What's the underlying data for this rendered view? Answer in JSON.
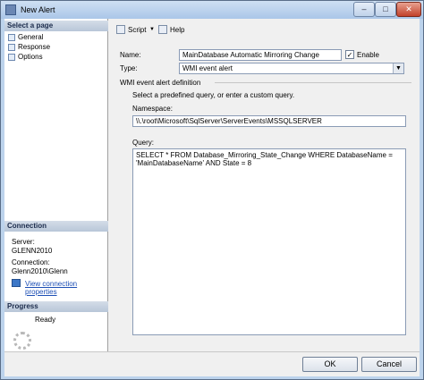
{
  "window": {
    "title": "New Alert"
  },
  "left": {
    "select_page_header": "Select a page",
    "pages": [
      "General",
      "Response",
      "Options"
    ],
    "connection_header": "Connection",
    "server_label": "Server:",
    "server_value": "GLENN2010",
    "connection_label": "Connection:",
    "connection_value": "Glenn2010\\Glenn",
    "view_properties_link": "View connection properties",
    "progress_header": "Progress",
    "progress_status": "Ready"
  },
  "toolbar": {
    "script_label": "Script",
    "help_label": "Help"
  },
  "form": {
    "name_label": "Name:",
    "name_value": "MainDatabase Automatic Mirroring Change",
    "enable_label": "Enable",
    "enable_checked": true,
    "type_label": "Type:",
    "type_value": "WMI event alert",
    "wmi_group_label": "WMI event alert definition",
    "instruction": "Select a predefined query, or enter a custom query.",
    "namespace_label": "Namespace:",
    "namespace_value": "\\\\.\\root\\Microsoft\\SqlServer\\ServerEvents\\MSSQLSERVER",
    "query_label": "Query:",
    "query_line1": "SELECT * FROM Database_Mirroring_State_Change WHERE DatabaseName =",
    "query_line2": "'MainDatabaseName' AND State = 8"
  },
  "buttons": {
    "ok": "OK",
    "cancel": "Cancel"
  },
  "icons": [
    "alert-icon",
    "page-icon",
    "script-icon",
    "help-icon",
    "connection-icon",
    "progress-spinner-icon"
  ]
}
